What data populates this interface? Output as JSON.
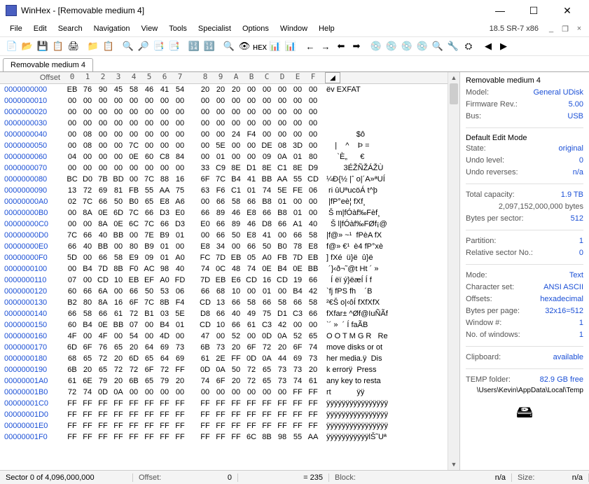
{
  "title": "WinHex - [Removable medium 4]",
  "version": "18.5 SR-7 x86",
  "menus": [
    "File",
    "Edit",
    "Search",
    "Navigation",
    "View",
    "Tools",
    "Specialist",
    "Options",
    "Window",
    "Help"
  ],
  "tab": "Removable medium 4",
  "hex_cols": [
    "0",
    "1",
    "2",
    "3",
    "4",
    "5",
    "6",
    "7",
    "8",
    "9",
    "A",
    "B",
    "C",
    "D",
    "E",
    "F"
  ],
  "rows": [
    {
      "o": "0000000000",
      "b": [
        "EB",
        "76",
        "90",
        "45",
        "58",
        "46",
        "41",
        "54",
        "20",
        "20",
        "20",
        "00",
        "00",
        "00",
        "00",
        "00"
      ],
      "a": "ëv EXFAT"
    },
    {
      "o": "0000000010",
      "b": [
        "00",
        "00",
        "00",
        "00",
        "00",
        "00",
        "00",
        "00",
        "00",
        "00",
        "00",
        "00",
        "00",
        "00",
        "00",
        "00"
      ],
      "a": ""
    },
    {
      "o": "0000000020",
      "b": [
        "00",
        "00",
        "00",
        "00",
        "00",
        "00",
        "00",
        "00",
        "00",
        "00",
        "00",
        "00",
        "00",
        "00",
        "00",
        "00"
      ],
      "a": ""
    },
    {
      "o": "0000000030",
      "b": [
        "00",
        "00",
        "00",
        "00",
        "00",
        "00",
        "00",
        "00",
        "00",
        "00",
        "00",
        "00",
        "00",
        "00",
        "00",
        "00"
      ],
      "a": ""
    },
    {
      "o": "0000000040",
      "b": [
        "00",
        "08",
        "00",
        "00",
        "00",
        "00",
        "00",
        "00",
        "00",
        "00",
        "24",
        "F4",
        "00",
        "00",
        "00",
        "00"
      ],
      "a": "              $ô"
    },
    {
      "o": "0000000050",
      "b": [
        "00",
        "08",
        "00",
        "00",
        "7C",
        "00",
        "00",
        "00",
        "00",
        "5E",
        "00",
        "00",
        "DE",
        "08",
        "3D",
        "00"
      ],
      "a": "    |    ^    Þ ="
    },
    {
      "o": "0000000060",
      "b": [
        "04",
        "00",
        "00",
        "00",
        "0E",
        "60",
        "C8",
        "84",
        "00",
        "01",
        "00",
        "00",
        "09",
        "0A",
        "01",
        "80"
      ],
      "a": "     `È„      €"
    },
    {
      "o": "0000000070",
      "b": [
        "00",
        "00",
        "00",
        "00",
        "00",
        "00",
        "00",
        "00",
        "33",
        "C9",
        "8E",
        "D1",
        "8E",
        "C1",
        "8E",
        "D9"
      ],
      "a": "        3ÉŽÑŽÁŽÙ"
    },
    {
      "o": "0000000080",
      "b": [
        "BC",
        "D0",
        "7B",
        "BD",
        "00",
        "7C",
        "88",
        "16",
        "6F",
        "7C",
        "B4",
        "41",
        "BB",
        "AA",
        "55",
        "CD"
      ],
      "a": "¼Ð{½ |ˆ o|´A»ªUÍ"
    },
    {
      "o": "0000000090",
      "b": [
        "13",
        "72",
        "69",
        "81",
        "FB",
        "55",
        "AA",
        "75",
        "63",
        "F6",
        "C1",
        "01",
        "74",
        "5E",
        "FE",
        "06"
      ],
      "a": " ri ûUªucöÁ t^þ"
    },
    {
      "o": "00000000A0",
      "b": [
        "02",
        "7C",
        "66",
        "50",
        "B0",
        "65",
        "E8",
        "A6",
        "00",
        "66",
        "58",
        "66",
        "B8",
        "01",
        "00",
        "00"
      ],
      "a": " |fP°eè¦ fXf¸"
    },
    {
      "o": "00000000B0",
      "b": [
        "00",
        "8A",
        "0E",
        "6D",
        "7C",
        "66",
        "D3",
        "E0",
        "66",
        "89",
        "46",
        "E8",
        "66",
        "B8",
        "01",
        "00"
      ],
      "a": " Š m|fÓàf‰Fèf¸"
    },
    {
      "o": "00000000C0",
      "b": [
        "00",
        "00",
        "8A",
        "0E",
        "6C",
        "7C",
        "66",
        "D3",
        "E0",
        "66",
        "89",
        "46",
        "D8",
        "66",
        "A1",
        "40"
      ],
      "a": "  Š l|fÓàf‰FØf¡@"
    },
    {
      "o": "00000000D0",
      "b": [
        "7C",
        "66",
        "40",
        "BB",
        "00",
        "7E",
        "B9",
        "01",
        "00",
        "66",
        "50",
        "E8",
        "41",
        "00",
        "66",
        "58"
      ],
      "a": "|f@» ~¹  fPèA fX"
    },
    {
      "o": "00000000E0",
      "b": [
        "66",
        "40",
        "BB",
        "00",
        "80",
        "B9",
        "01",
        "00",
        "E8",
        "34",
        "00",
        "66",
        "50",
        "B0",
        "78",
        "E8"
      ],
      "a": "f@» €¹  è4 fP°xè"
    },
    {
      "o": "00000000F0",
      "b": [
        "5D",
        "00",
        "66",
        "58",
        "E9",
        "09",
        "01",
        "A0",
        "FC",
        "7D",
        "EB",
        "05",
        "A0",
        "FB",
        "7D",
        "EB"
      ],
      "a": "] fXé  ü}ë  û}ë"
    },
    {
      "o": "0000000100",
      "b": [
        "00",
        "B4",
        "7D",
        "8B",
        "F0",
        "AC",
        "98",
        "40",
        "74",
        "0C",
        "48",
        "74",
        "0E",
        "B4",
        "0E",
        "BB"
      ],
      "a": " ´}‹ð¬˜@t Ht ´ »"
    },
    {
      "o": "0000000110",
      "b": [
        "07",
        "00",
        "CD",
        "10",
        "EB",
        "EF",
        "A0",
        "FD",
        "7D",
        "EB",
        "E6",
        "CD",
        "16",
        "CD",
        "19",
        "66"
      ],
      "a": "  Í ëï ý}ëæÍ Í f"
    },
    {
      "o": "0000000120",
      "b": [
        "60",
        "66",
        "6A",
        "00",
        "66",
        "50",
        "53",
        "06",
        "66",
        "68",
        "10",
        "00",
        "01",
        "00",
        "B4",
        "42"
      ],
      "a": "`fj fPS fh    ´B"
    },
    {
      "o": "0000000130",
      "b": [
        "B2",
        "80",
        "8A",
        "16",
        "6F",
        "7C",
        "8B",
        "F4",
        "CD",
        "13",
        "66",
        "58",
        "66",
        "58",
        "66",
        "58"
      ],
      "a": "²€Š o|‹ôÍ fXfXfX"
    },
    {
      "o": "0000000140",
      "b": [
        "66",
        "58",
        "66",
        "61",
        "72",
        "B1",
        "03",
        "5E",
        "D8",
        "66",
        "40",
        "49",
        "75",
        "D1",
        "C3",
        "66"
      ],
      "a": "fXfar± ^Øf@IuÑÃf"
    },
    {
      "o": "0000000150",
      "b": [
        "60",
        "B4",
        "0E",
        "BB",
        "07",
        "00",
        "B4",
        "01",
        "CD",
        "10",
        "66",
        "61",
        "C3",
        "42",
        "00",
        "00"
      ],
      "a": "`´ »  ´ Í faÃB"
    },
    {
      "o": "0000000160",
      "b": [
        "4F",
        "00",
        "4F",
        "00",
        "54",
        "00",
        "4D",
        "00",
        "47",
        "00",
        "52",
        "00",
        "0D",
        "0A",
        "52",
        "65"
      ],
      "a": "O O T M G R   Re"
    },
    {
      "o": "0000000170",
      "b": [
        "6D",
        "6F",
        "76",
        "65",
        "20",
        "64",
        "69",
        "73",
        "6B",
        "73",
        "20",
        "6F",
        "72",
        "20",
        "6F",
        "74"
      ],
      "a": "move disks or ot"
    },
    {
      "o": "0000000180",
      "b": [
        "68",
        "65",
        "72",
        "20",
        "6D",
        "65",
        "64",
        "69",
        "61",
        "2E",
        "FF",
        "0D",
        "0A",
        "44",
        "69",
        "73"
      ],
      "a": "her media.ÿ  Dis"
    },
    {
      "o": "0000000190",
      "b": [
        "6B",
        "20",
        "65",
        "72",
        "72",
        "6F",
        "72",
        "FF",
        "0D",
        "0A",
        "50",
        "72",
        "65",
        "73",
        "73",
        "20"
      ],
      "a": "k errorÿ  Press"
    },
    {
      "o": "00000001A0",
      "b": [
        "61",
        "6E",
        "79",
        "20",
        "6B",
        "65",
        "79",
        "20",
        "74",
        "6F",
        "20",
        "72",
        "65",
        "73",
        "74",
        "61"
      ],
      "a": "any key to resta"
    },
    {
      "o": "00000001B0",
      "b": [
        "72",
        "74",
        "0D",
        "0A",
        "00",
        "00",
        "00",
        "00",
        "00",
        "00",
        "00",
        "00",
        "00",
        "00",
        "FF",
        "FF"
      ],
      "a": "rt            ÿÿ"
    },
    {
      "o": "00000001C0",
      "b": [
        "FF",
        "FF",
        "FF",
        "FF",
        "FF",
        "FF",
        "FF",
        "FF",
        "FF",
        "FF",
        "FF",
        "FF",
        "FF",
        "FF",
        "FF",
        "FF"
      ],
      "a": "ÿÿÿÿÿÿÿÿÿÿÿÿÿÿÿÿ"
    },
    {
      "o": "00000001D0",
      "b": [
        "FF",
        "FF",
        "FF",
        "FF",
        "FF",
        "FF",
        "FF",
        "FF",
        "FF",
        "FF",
        "FF",
        "FF",
        "FF",
        "FF",
        "FF",
        "FF"
      ],
      "a": "ÿÿÿÿÿÿÿÿÿÿÿÿÿÿÿÿ"
    },
    {
      "o": "00000001E0",
      "b": [
        "FF",
        "FF",
        "FF",
        "FF",
        "FF",
        "FF",
        "FF",
        "FF",
        "FF",
        "FF",
        "FF",
        "FF",
        "FF",
        "FF",
        "FF",
        "FF"
      ],
      "a": "ÿÿÿÿÿÿÿÿÿÿÿÿÿÿÿÿ"
    },
    {
      "o": "00000001F0",
      "b": [
        "FF",
        "FF",
        "FF",
        "FF",
        "FF",
        "FF",
        "FF",
        "FF",
        "FF",
        "FF",
        "FF",
        "6C",
        "8B",
        "98",
        "55",
        "AA"
      ],
      "a": "ÿÿÿÿÿÿÿÿÿÿÿlŠ˜Uª"
    }
  ],
  "side": {
    "title": "Removable medium 4",
    "model_k": "Model:",
    "model_v": "General UDisk",
    "fw_k": "Firmware Rev.:",
    "fw_v": "5.00",
    "bus_k": "Bus:",
    "bus_v": "USB",
    "mode_k": "Default Edit Mode",
    "state_k": "State:",
    "state_v": "original",
    "undo_k": "Undo level:",
    "undo_v": "0",
    "undor_k": "Undo reverses:",
    "undor_v": "n/a",
    "cap_k": "Total capacity:",
    "cap_v": "1.9 TB",
    "cap_b": "2,097,152,000,000 bytes",
    "bps_k": "Bytes per sector:",
    "bps_v": "512",
    "part_k": "Partition:",
    "part_v": "1",
    "rel_k": "Relative sector No.:",
    "rel_v": "0",
    "mode2_k": "Mode:",
    "mode2_v": "Text",
    "cs_k": "Character set:",
    "cs_v": "ANSI ASCII",
    "off_k": "Offsets:",
    "off_v": "hexadecimal",
    "bpp_k": "Bytes per page:",
    "bpp_v": "32x16=512",
    "win_k": "Window #:",
    "win_v": "1",
    "now_k": "No. of windows:",
    "now_v": "1",
    "clip_k": "Clipboard:",
    "clip_v": "available",
    "temp_k": "TEMP folder:",
    "temp_v": "82.9 GB free",
    "temp_path": "\\Users\\Kevin\\AppData\\Local\\Temp"
  },
  "status": {
    "sector": "Sector 0 of 4,096,000,000",
    "offset_k": "Offset:",
    "offset_v": "0",
    "eq": "= 235",
    "block_k": "Block:",
    "block_v": "n/a",
    "size_k": "Size:",
    "size_v": "n/a"
  },
  "toolbar_icons": [
    "📄",
    "📂",
    "💾",
    "📋",
    "🖨",
    "",
    "📁",
    "📋",
    "",
    "🔍",
    "🔎",
    "📑",
    "📑",
    "",
    "🔢",
    "🔢",
    "",
    "🔍",
    "👁",
    "ʜᴇx",
    "📊",
    "📊",
    "",
    "←",
    "→",
    "⬅",
    "➡",
    "",
    "💿",
    "💿",
    "💿",
    "💿",
    "🔍",
    "🔧",
    "⛭",
    "",
    "◀",
    "▶"
  ]
}
